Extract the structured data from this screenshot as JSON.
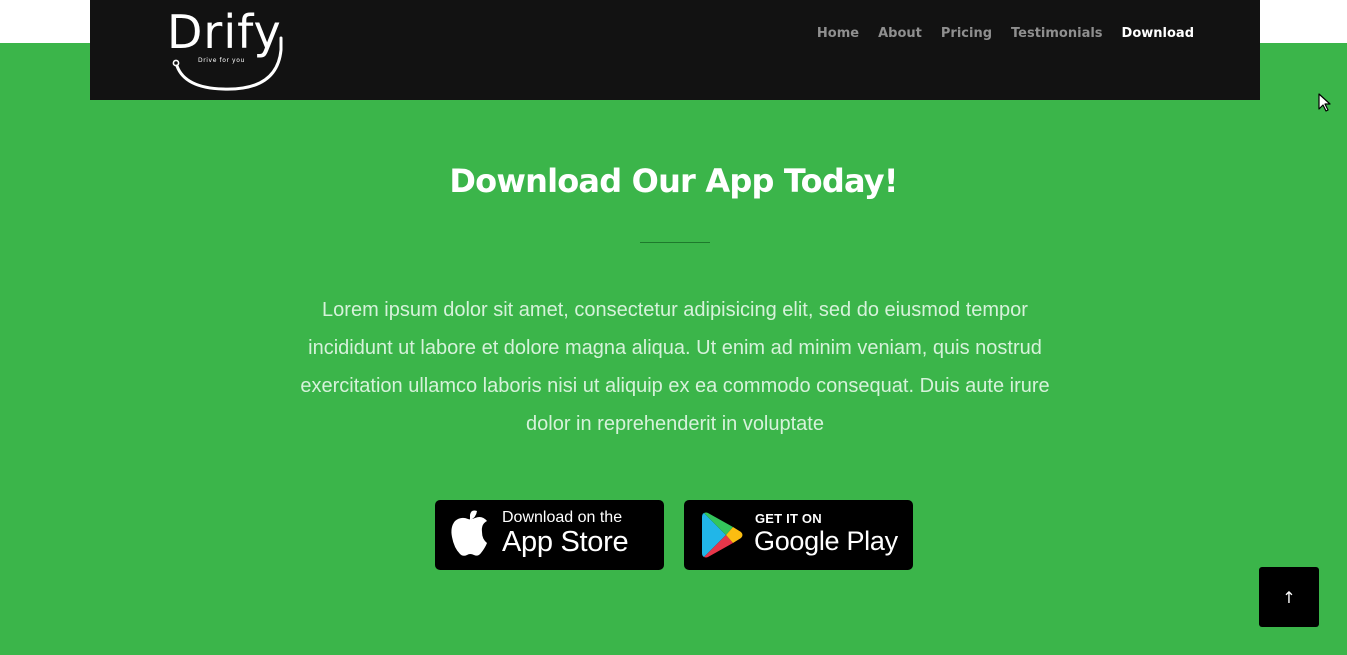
{
  "brand": {
    "name": "Drify",
    "tagline": "Drive for you"
  },
  "nav": {
    "items": [
      {
        "label": "Home"
      },
      {
        "label": "About"
      },
      {
        "label": "Pricing"
      },
      {
        "label": "Testimonials"
      },
      {
        "label": "Download",
        "active": true
      }
    ]
  },
  "download": {
    "heading": "Download Our App Today!",
    "description": "Lorem ipsum dolor sit amet, consectetur adipisicing elit, sed do eiusmod tempor incididunt ut labore et dolore magna aliqua. Ut enim ad minim veniam, quis nostrud exercitation ullamco laboris nisi ut aliquip ex ea commodo consequat. Duis aute irure dolor in reprehenderit in voluptate"
  },
  "app_store": {
    "small": "Download on the",
    "big": "App Store",
    "icon": "apple-icon"
  },
  "google_play": {
    "small": "GET IT ON",
    "big": "Google Play",
    "icon": "google-play-icon"
  },
  "scroll_top": {
    "icon": "arrow-up-icon",
    "glyph": "↑"
  },
  "colors": {
    "page_background": "#3bb54a",
    "navbar": "#121212",
    "nav_inactive": "#8f8f8f",
    "nav_active": "#ffffff",
    "description_text": "#d6f2da",
    "button_background": "#000000"
  }
}
